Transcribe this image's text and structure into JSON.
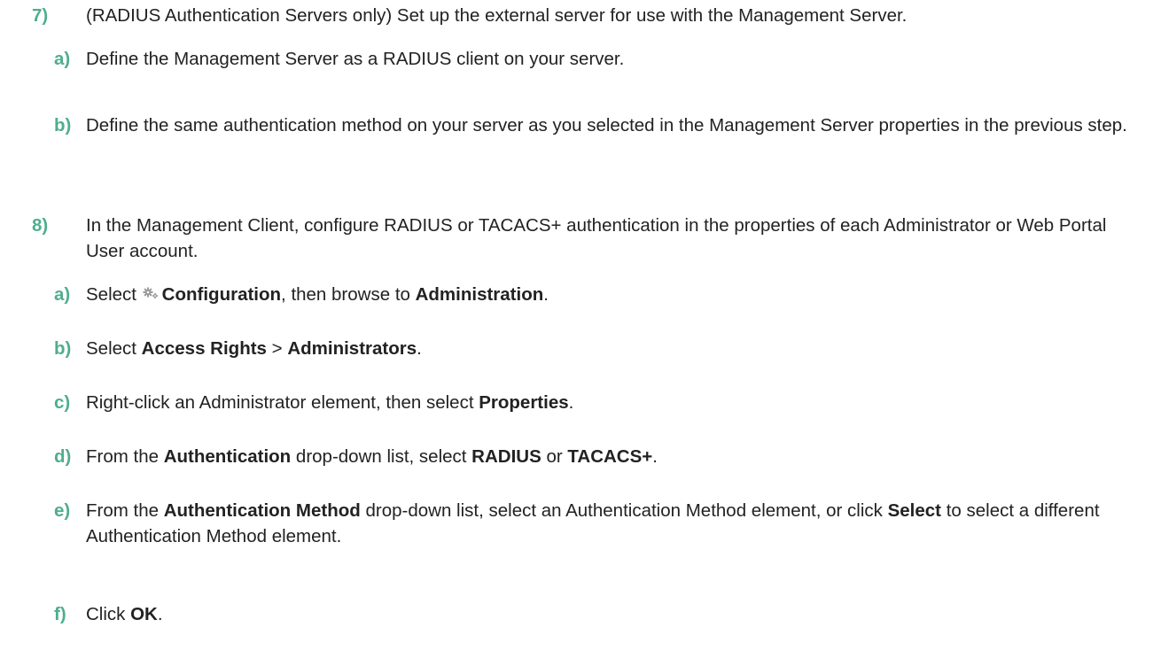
{
  "steps": [
    {
      "number": "7)",
      "text": "(RADIUS Authentication Servers only) Set up the external server for use with the Management Server.",
      "substeps": [
        {
          "letter": "a)",
          "text": "Define the Management Server as a RADIUS client on your server."
        },
        {
          "letter": "b)",
          "text": "Define the same authentication method on your server as you selected in the Management Server properties in the previous step."
        }
      ]
    },
    {
      "number": "8)",
      "text": "In the Management Client, configure RADIUS or TACACS+ authentication in the properties of each Administrator or Web Portal User account.",
      "substeps": [
        {
          "letter": "a)",
          "parts": [
            "Select ",
            "Configuration",
            ", then browse to ",
            "Administration",
            "."
          ],
          "icon": "gear-icon"
        },
        {
          "letter": "b)",
          "parts": [
            "Select ",
            "Access Rights",
            " > ",
            "Administrators",
            "."
          ]
        },
        {
          "letter": "c)",
          "parts": [
            "Right-click an Administrator element, then select ",
            "Properties",
            "."
          ]
        },
        {
          "letter": "d)",
          "parts": [
            "From the ",
            "Authentication",
            " drop-down list, select ",
            "RADIUS",
            " or ",
            "TACACS+",
            "."
          ]
        },
        {
          "letter": "e)",
          "parts": [
            "From the ",
            "Authentication Method",
            " drop-down list, select an Authentication Method element, or click ",
            "Select",
            " to select a different Authentication Method element."
          ]
        },
        {
          "letter": "f)",
          "parts": [
            "Click ",
            "OK",
            "."
          ]
        }
      ]
    }
  ],
  "colors": {
    "accent": "#4fae8c",
    "text": "#222222",
    "icon": "#9a9a9a"
  }
}
